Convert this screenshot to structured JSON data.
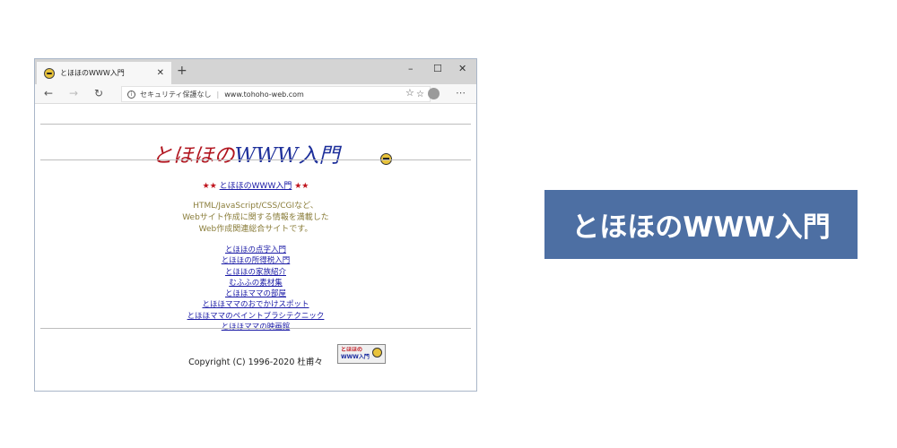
{
  "browser": {
    "tab_title": "とほほのWWW入門",
    "tab_close": "✕",
    "new_tab": "+",
    "minimize": "–",
    "maximize": "☐",
    "close": "✕",
    "back": "←",
    "forward": "→",
    "refresh": "↻",
    "security_text": "セキュリティ保護なし",
    "url": "www.tohoho-web.com",
    "more": "⋯"
  },
  "page": {
    "title_red": "とほほの",
    "title_blue": "WWW入門",
    "crumb_stars_left": "★★",
    "crumb_link": "とほほのWWW入門",
    "crumb_stars_right": "★★",
    "description": [
      "HTML/JavaScript/CSS/CGIなど、",
      "Webサイト作成に関する情報を満載した",
      "Web作成関連総合サイトです。"
    ],
    "links": [
      "とほほの点字入門",
      "とほほの所得税入門",
      "とほほの家族紹介",
      "むふふの素材集",
      "とほほママの部屋",
      "とほほママのおでかけスポット",
      "とほほママのペイントブラシテクニック",
      "とほほママの映画館"
    ],
    "copyright": "Copyright (C) 1996-2020 杜甫々",
    "badge_line1": "とほほの",
    "badge_line2": "WWW入門"
  },
  "banner": {
    "text": "とほほのWWW入門",
    "bg_color": "#4d6fa3"
  },
  "icons": [
    "smiley-favicon-icon",
    "info-icon",
    "star-icon",
    "favorites-icon",
    "avatar-icon"
  ]
}
